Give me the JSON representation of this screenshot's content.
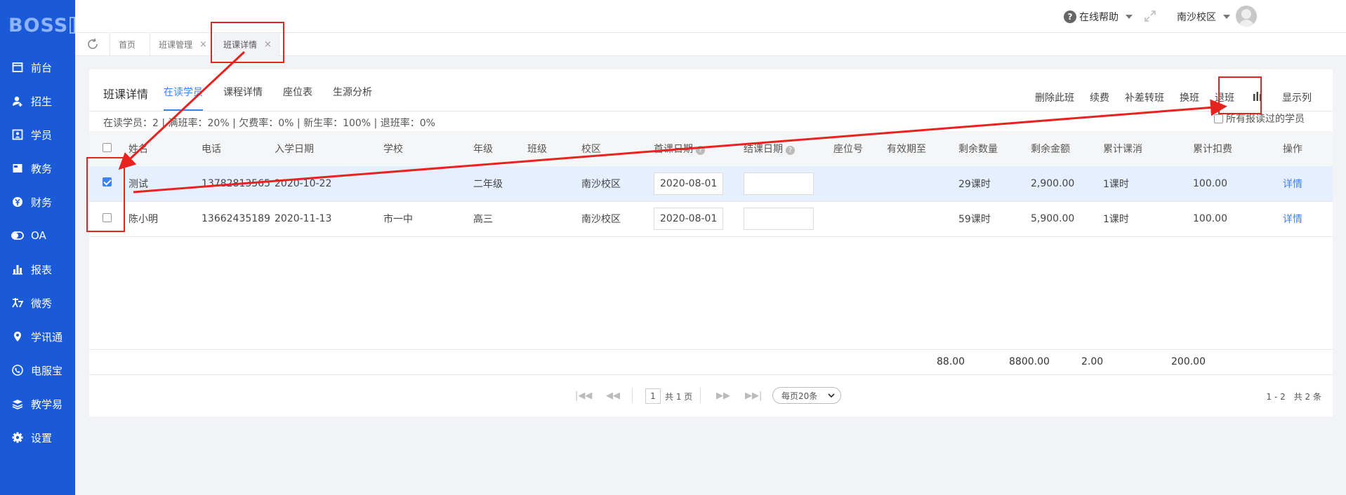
{
  "brand": {
    "logo_text": "BOSS",
    "logo_box": "BOSS"
  },
  "colors": {
    "sidebar_bg": "#1a5ad8",
    "accent": "#3b82f6",
    "annotation": "#e8231f",
    "selected_row": "#e6efff"
  },
  "sidebar": {
    "items": [
      {
        "label": "前台",
        "icon": "window-icon"
      },
      {
        "label": "招生",
        "icon": "user-add-icon"
      },
      {
        "label": "学员",
        "icon": "id-card-icon"
      },
      {
        "label": "教务",
        "icon": "book-icon"
      },
      {
        "label": "财务",
        "icon": "yen-icon"
      },
      {
        "label": "OA",
        "icon": "toggle-icon"
      },
      {
        "label": "报表",
        "icon": "bar-chart-icon"
      },
      {
        "label": "微秀",
        "icon": "show-icon"
      },
      {
        "label": "学讯通",
        "icon": "location-icon"
      },
      {
        "label": "电服宝",
        "icon": "phone-icon"
      },
      {
        "label": "教学易",
        "icon": "stack-icon"
      },
      {
        "label": "设置",
        "icon": "gear-icon"
      }
    ]
  },
  "header": {
    "help_label": "在线帮助",
    "campus_label": "南沙校区"
  },
  "page_tabs": [
    {
      "label": "首页",
      "closable": false
    },
    {
      "label": "班课管理",
      "closable": true
    },
    {
      "label": "班课详情",
      "closable": true,
      "active": true
    }
  ],
  "close_symbol": "×",
  "card": {
    "title": "班课详情",
    "subtabs": [
      "在读学员",
      "课程详情",
      "座位表",
      "生源分析"
    ],
    "actions": [
      "删除此班",
      "续费",
      "补差转班",
      "换班",
      "退班"
    ],
    "show_columns_label": "显示列",
    "stats": "在读学员：2 | 满班率：20% | 欠费率：0% | 新生率：100% | 退班率：0%",
    "show_all_label": "所有报读过的学员"
  },
  "table": {
    "headers": [
      "姓名",
      "电话",
      "入学日期",
      "学校",
      "年级",
      "班级",
      "校区",
      "首课日期",
      "结课日期",
      "座位号",
      "有效期至",
      "剩余数量",
      "剩余金额",
      "累计课消",
      "累计扣费",
      "操作"
    ],
    "help_mark": "?",
    "rows": [
      {
        "checked": true,
        "name": "测试",
        "phone": "13782813565",
        "enroll_date": "2020-10-22",
        "school": "",
        "grade": "二年级",
        "class": "",
        "campus": "南沙校区",
        "first_date": "2020-08-01",
        "end_date": "",
        "seat": "",
        "valid_until": "",
        "remain_qty": "29课时",
        "remain_amount": "2,900.00",
        "consumed": "1课时",
        "deducted": "100.00",
        "action": "详情"
      },
      {
        "checked": false,
        "name": "陈小明",
        "phone": "13662435189",
        "enroll_date": "2020-11-13",
        "school": "市一中",
        "grade": "高三",
        "class": "",
        "campus": "南沙校区",
        "first_date": "2020-08-01",
        "end_date": "",
        "seat": "",
        "valid_until": "",
        "remain_qty": "59课时",
        "remain_amount": "5,900.00",
        "consumed": "1课时",
        "deducted": "100.00",
        "action": "详情"
      }
    ],
    "totals": {
      "remain_qty": "88.00",
      "remain_amount": "8800.00",
      "consumed": "2.00",
      "deducted": "200.00"
    }
  },
  "pager": {
    "page": "1",
    "total_pages": "共 1 页",
    "per_page": "每页20条",
    "range": "1 - 2　共 2 条"
  }
}
